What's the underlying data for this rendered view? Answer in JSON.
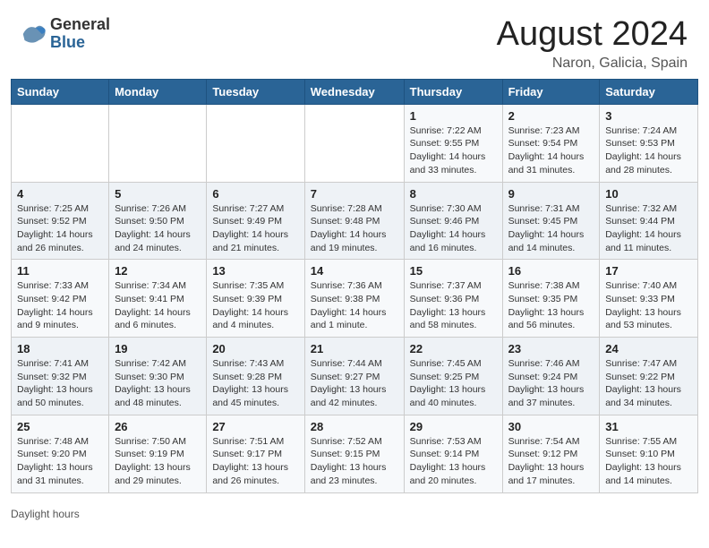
{
  "header": {
    "logo_general": "General",
    "logo_blue": "Blue",
    "month_year": "August 2024",
    "location": "Naron, Galicia, Spain"
  },
  "days_of_week": [
    "Sunday",
    "Monday",
    "Tuesday",
    "Wednesday",
    "Thursday",
    "Friday",
    "Saturday"
  ],
  "weeks": [
    [
      {
        "day": "",
        "info": ""
      },
      {
        "day": "",
        "info": ""
      },
      {
        "day": "",
        "info": ""
      },
      {
        "day": "",
        "info": ""
      },
      {
        "day": "1",
        "info": "Sunrise: 7:22 AM\nSunset: 9:55 PM\nDaylight: 14 hours and 33 minutes."
      },
      {
        "day": "2",
        "info": "Sunrise: 7:23 AM\nSunset: 9:54 PM\nDaylight: 14 hours and 31 minutes."
      },
      {
        "day": "3",
        "info": "Sunrise: 7:24 AM\nSunset: 9:53 PM\nDaylight: 14 hours and 28 minutes."
      }
    ],
    [
      {
        "day": "4",
        "info": "Sunrise: 7:25 AM\nSunset: 9:52 PM\nDaylight: 14 hours and 26 minutes."
      },
      {
        "day": "5",
        "info": "Sunrise: 7:26 AM\nSunset: 9:50 PM\nDaylight: 14 hours and 24 minutes."
      },
      {
        "day": "6",
        "info": "Sunrise: 7:27 AM\nSunset: 9:49 PM\nDaylight: 14 hours and 21 minutes."
      },
      {
        "day": "7",
        "info": "Sunrise: 7:28 AM\nSunset: 9:48 PM\nDaylight: 14 hours and 19 minutes."
      },
      {
        "day": "8",
        "info": "Sunrise: 7:30 AM\nSunset: 9:46 PM\nDaylight: 14 hours and 16 minutes."
      },
      {
        "day": "9",
        "info": "Sunrise: 7:31 AM\nSunset: 9:45 PM\nDaylight: 14 hours and 14 minutes."
      },
      {
        "day": "10",
        "info": "Sunrise: 7:32 AM\nSunset: 9:44 PM\nDaylight: 14 hours and 11 minutes."
      }
    ],
    [
      {
        "day": "11",
        "info": "Sunrise: 7:33 AM\nSunset: 9:42 PM\nDaylight: 14 hours and 9 minutes."
      },
      {
        "day": "12",
        "info": "Sunrise: 7:34 AM\nSunset: 9:41 PM\nDaylight: 14 hours and 6 minutes."
      },
      {
        "day": "13",
        "info": "Sunrise: 7:35 AM\nSunset: 9:39 PM\nDaylight: 14 hours and 4 minutes."
      },
      {
        "day": "14",
        "info": "Sunrise: 7:36 AM\nSunset: 9:38 PM\nDaylight: 14 hours and 1 minute."
      },
      {
        "day": "15",
        "info": "Sunrise: 7:37 AM\nSunset: 9:36 PM\nDaylight: 13 hours and 58 minutes."
      },
      {
        "day": "16",
        "info": "Sunrise: 7:38 AM\nSunset: 9:35 PM\nDaylight: 13 hours and 56 minutes."
      },
      {
        "day": "17",
        "info": "Sunrise: 7:40 AM\nSunset: 9:33 PM\nDaylight: 13 hours and 53 minutes."
      }
    ],
    [
      {
        "day": "18",
        "info": "Sunrise: 7:41 AM\nSunset: 9:32 PM\nDaylight: 13 hours and 50 minutes."
      },
      {
        "day": "19",
        "info": "Sunrise: 7:42 AM\nSunset: 9:30 PM\nDaylight: 13 hours and 48 minutes."
      },
      {
        "day": "20",
        "info": "Sunrise: 7:43 AM\nSunset: 9:28 PM\nDaylight: 13 hours and 45 minutes."
      },
      {
        "day": "21",
        "info": "Sunrise: 7:44 AM\nSunset: 9:27 PM\nDaylight: 13 hours and 42 minutes."
      },
      {
        "day": "22",
        "info": "Sunrise: 7:45 AM\nSunset: 9:25 PM\nDaylight: 13 hours and 40 minutes."
      },
      {
        "day": "23",
        "info": "Sunrise: 7:46 AM\nSunset: 9:24 PM\nDaylight: 13 hours and 37 minutes."
      },
      {
        "day": "24",
        "info": "Sunrise: 7:47 AM\nSunset: 9:22 PM\nDaylight: 13 hours and 34 minutes."
      }
    ],
    [
      {
        "day": "25",
        "info": "Sunrise: 7:48 AM\nSunset: 9:20 PM\nDaylight: 13 hours and 31 minutes."
      },
      {
        "day": "26",
        "info": "Sunrise: 7:50 AM\nSunset: 9:19 PM\nDaylight: 13 hours and 29 minutes."
      },
      {
        "day": "27",
        "info": "Sunrise: 7:51 AM\nSunset: 9:17 PM\nDaylight: 13 hours and 26 minutes."
      },
      {
        "day": "28",
        "info": "Sunrise: 7:52 AM\nSunset: 9:15 PM\nDaylight: 13 hours and 23 minutes."
      },
      {
        "day": "29",
        "info": "Sunrise: 7:53 AM\nSunset: 9:14 PM\nDaylight: 13 hours and 20 minutes."
      },
      {
        "day": "30",
        "info": "Sunrise: 7:54 AM\nSunset: 9:12 PM\nDaylight: 13 hours and 17 minutes."
      },
      {
        "day": "31",
        "info": "Sunrise: 7:55 AM\nSunset: 9:10 PM\nDaylight: 13 hours and 14 minutes."
      }
    ]
  ],
  "footer": {
    "daylight_label": "Daylight hours"
  }
}
